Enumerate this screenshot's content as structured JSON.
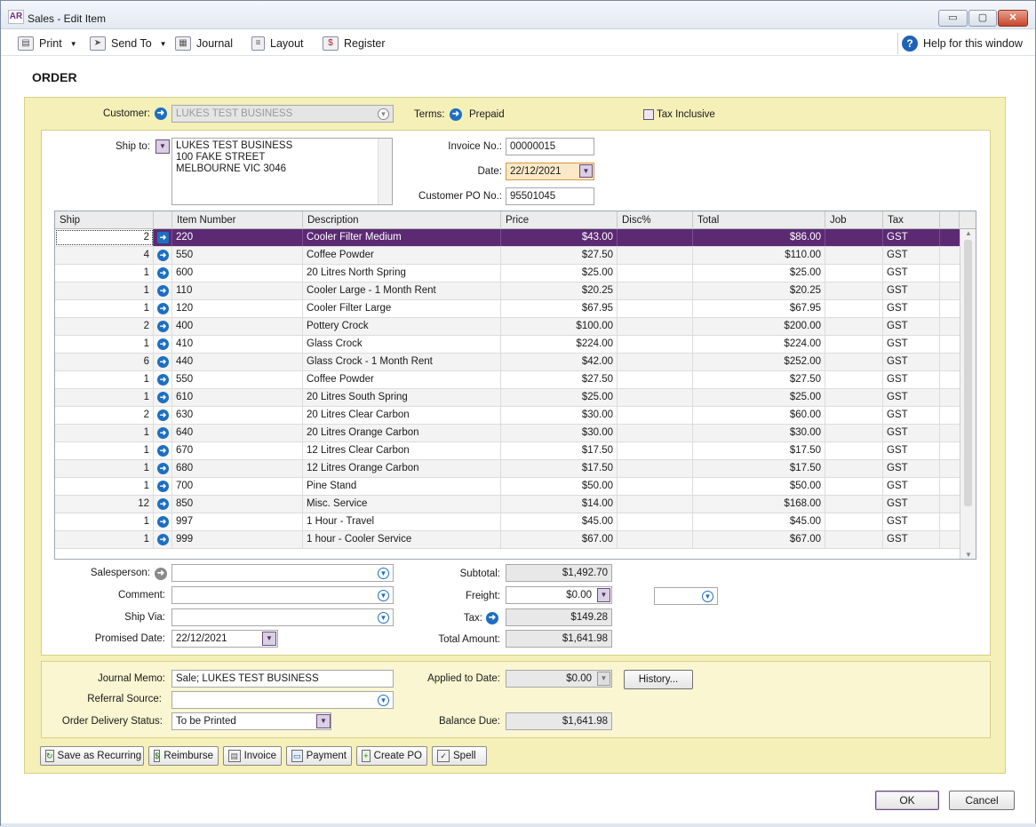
{
  "window": {
    "app_icon": "AR",
    "title": "Sales - Edit Item",
    "controls": {
      "minimize": "▭",
      "maximize": "▢",
      "close": "✕"
    }
  },
  "toolbar": {
    "print": "Print",
    "send_to": "Send To",
    "journal": "Journal",
    "layout": "Layout",
    "register": "Register",
    "help": "Help for this window",
    "help_glyph": "?"
  },
  "form": {
    "heading": "ORDER",
    "customer_label": "Customer:",
    "customer_value": "LUKES TEST BUSINESS",
    "terms_label": "Terms:",
    "terms_value": "Prepaid",
    "tax_inclusive_label": "Tax Inclusive",
    "ship_to_label": "Ship to:",
    "ship_to_lines": [
      "LUKES TEST BUSINESS",
      "100 FAKE STREET",
      "MELBOURNE VIC 3046"
    ],
    "invoice_no_label": "Invoice No.:",
    "invoice_no": "00000015",
    "date_label": "Date:",
    "date": "22/12/2021",
    "customer_po_label": "Customer PO No.:",
    "customer_po": "95501045"
  },
  "grid": {
    "headers": [
      "Ship",
      "",
      "Item Number",
      "Description",
      "Price",
      "Disc%",
      "Total",
      "Job",
      "Tax"
    ],
    "rows": [
      {
        "ship": "2",
        "item": "220",
        "desc": "Cooler Filter Medium",
        "price": "$43.00",
        "disc": "",
        "total": "$86.00",
        "job": "",
        "tax": "GST"
      },
      {
        "ship": "4",
        "item": "550",
        "desc": "Coffee Powder",
        "price": "$27.50",
        "disc": "",
        "total": "$110.00",
        "job": "",
        "tax": "GST"
      },
      {
        "ship": "1",
        "item": "600",
        "desc": "20 Litres North Spring",
        "price": "$25.00",
        "disc": "",
        "total": "$25.00",
        "job": "",
        "tax": "GST"
      },
      {
        "ship": "1",
        "item": "110",
        "desc": "Cooler Large - 1 Month Rent",
        "price": "$20.25",
        "disc": "",
        "total": "$20.25",
        "job": "",
        "tax": "GST"
      },
      {
        "ship": "1",
        "item": "120",
        "desc": "Cooler Filter Large",
        "price": "$67.95",
        "disc": "",
        "total": "$67.95",
        "job": "",
        "tax": "GST"
      },
      {
        "ship": "2",
        "item": "400",
        "desc": "Pottery Crock",
        "price": "$100.00",
        "disc": "",
        "total": "$200.00",
        "job": "",
        "tax": "GST"
      },
      {
        "ship": "1",
        "item": "410",
        "desc": "Glass Crock",
        "price": "$224.00",
        "disc": "",
        "total": "$224.00",
        "job": "",
        "tax": "GST"
      },
      {
        "ship": "6",
        "item": "440",
        "desc": "Glass Crock - 1 Month Rent",
        "price": "$42.00",
        "disc": "",
        "total": "$252.00",
        "job": "",
        "tax": "GST"
      },
      {
        "ship": "1",
        "item": "550",
        "desc": "Coffee Powder",
        "price": "$27.50",
        "disc": "",
        "total": "$27.50",
        "job": "",
        "tax": "GST"
      },
      {
        "ship": "1",
        "item": "610",
        "desc": "20 Litres South Spring",
        "price": "$25.00",
        "disc": "",
        "total": "$25.00",
        "job": "",
        "tax": "GST"
      },
      {
        "ship": "2",
        "item": "630",
        "desc": "20 Litres Clear Carbon",
        "price": "$30.00",
        "disc": "",
        "total": "$60.00",
        "job": "",
        "tax": "GST"
      },
      {
        "ship": "1",
        "item": "640",
        "desc": "20 Litres Orange Carbon",
        "price": "$30.00",
        "disc": "",
        "total": "$30.00",
        "job": "",
        "tax": "GST"
      },
      {
        "ship": "1",
        "item": "670",
        "desc": "12 Litres Clear Carbon",
        "price": "$17.50",
        "disc": "",
        "total": "$17.50",
        "job": "",
        "tax": "GST"
      },
      {
        "ship": "1",
        "item": "680",
        "desc": "12 Litres Orange Carbon",
        "price": "$17.50",
        "disc": "",
        "total": "$17.50",
        "job": "",
        "tax": "GST"
      },
      {
        "ship": "1",
        "item": "700",
        "desc": "Pine Stand",
        "price": "$50.00",
        "disc": "",
        "total": "$50.00",
        "job": "",
        "tax": "GST"
      },
      {
        "ship": "12",
        "item": "850",
        "desc": "Misc. Service",
        "price": "$14.00",
        "disc": "",
        "total": "$168.00",
        "job": "",
        "tax": "GST"
      },
      {
        "ship": "1",
        "item": "997",
        "desc": "1 Hour - Travel",
        "price": "$45.00",
        "disc": "",
        "total": "$45.00",
        "job": "",
        "tax": "GST"
      },
      {
        "ship": "1",
        "item": "999",
        "desc": "1 hour - Cooler Service",
        "price": "$67.00",
        "disc": "",
        "total": "$67.00",
        "job": "",
        "tax": "GST"
      }
    ]
  },
  "lower": {
    "salesperson_label": "Salesperson:",
    "comment_label": "Comment:",
    "ship_via_label": "Ship Via:",
    "promised_date_label": "Promised Date:",
    "promised_date": "22/12/2021",
    "subtotal_label": "Subtotal:",
    "subtotal": "$1,492.70",
    "freight_label": "Freight:",
    "freight": "$0.00",
    "tax_label": "Tax:",
    "tax": "$149.28",
    "total_label": "Total Amount:",
    "total": "$1,641.98"
  },
  "footer_panel": {
    "journal_memo_label": "Journal Memo:",
    "journal_memo": "Sale; LUKES TEST BUSINESS",
    "referral_label": "Referral Source:",
    "delivery_label": "Order Delivery Status:",
    "delivery_value": "To be Printed",
    "applied_label": "Applied to Date:",
    "applied_value": "$0.00",
    "history_button": "History...",
    "balance_label": "Balance Due:",
    "balance_value": "$1,641.98"
  },
  "actions": {
    "save_recurring": "Save as Recurring",
    "reimburse": "Reimburse",
    "invoice": "Invoice",
    "payment": "Payment",
    "create_po": "Create PO",
    "spell": "Spell"
  },
  "dialog": {
    "ok": "OK",
    "cancel": "Cancel"
  },
  "colors": {
    "selected_row": "#5b2a73",
    "panel_yellow": "#f5f0b8",
    "accent_blue": "#1d6fc2"
  }
}
